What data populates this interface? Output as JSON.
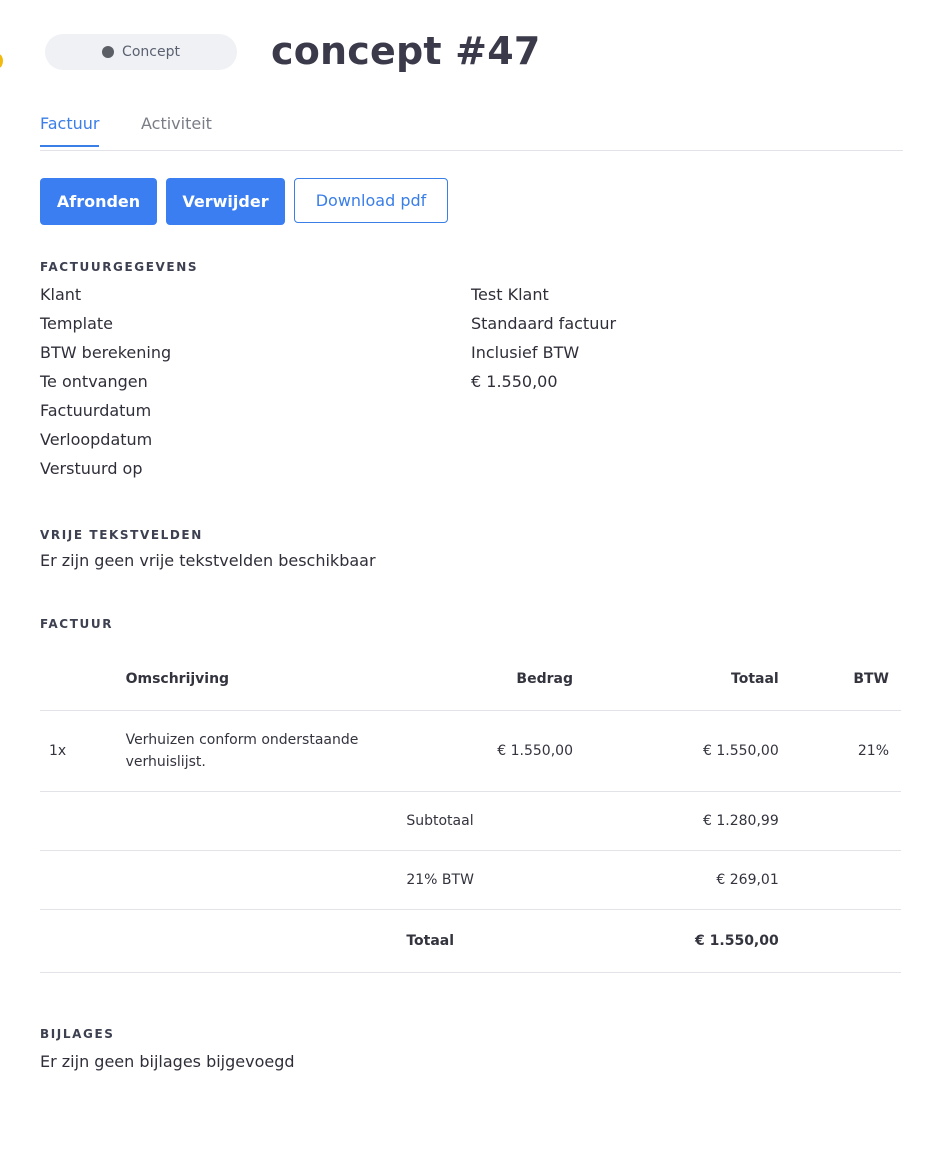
{
  "header": {
    "status": "Concept",
    "title": "concept #47"
  },
  "tabs": [
    {
      "label": "Factuur",
      "active": true
    },
    {
      "label": "Activiteit",
      "active": false
    }
  ],
  "actions": {
    "finish": "Afronden",
    "delete": "Verwijder",
    "download": "Download pdf"
  },
  "details": {
    "heading": "FACTUURGEGEVENS",
    "rows": [
      {
        "label": "Klant",
        "value": "Test Klant"
      },
      {
        "label": "Template",
        "value": "Standaard factuur"
      },
      {
        "label": "BTW berekening",
        "value": "Inclusief BTW"
      },
      {
        "label": "Te ontvangen",
        "value": "€ 1.550,00"
      },
      {
        "label": "Factuurdatum",
        "value": ""
      },
      {
        "label": "Verloopdatum",
        "value": ""
      },
      {
        "label": "Verstuurd op",
        "value": ""
      }
    ]
  },
  "free_fields": {
    "heading": "VRIJE TEKSTVELDEN",
    "empty_text": "Er zijn geen vrije tekstvelden beschikbaar"
  },
  "invoice": {
    "heading": "FACTUUR",
    "columns": {
      "description": "Omschrijving",
      "amount": "Bedrag",
      "total": "Totaal",
      "vat": "BTW"
    },
    "items": [
      {
        "qty": "1x",
        "description": "Verhuizen conform onderstaande verhuislijst.",
        "amount": "€ 1.550,00",
        "total": "€ 1.550,00",
        "vat": "21%"
      }
    ],
    "subtotal_label": "Subtotaal",
    "subtotal_value": "€ 1.280,99",
    "vat_label": "21% BTW",
    "vat_value": "€ 269,01",
    "total_label": "Totaal",
    "total_value": "€ 1.550,00"
  },
  "attachments": {
    "heading": "BIJLAGES",
    "empty_text": "Er zijn geen bijlages bijgevoegd"
  },
  "colors": {
    "accent": "#3a7ef2",
    "status_dot": "#5c5f66",
    "edge_accent": "#f2b90f"
  }
}
